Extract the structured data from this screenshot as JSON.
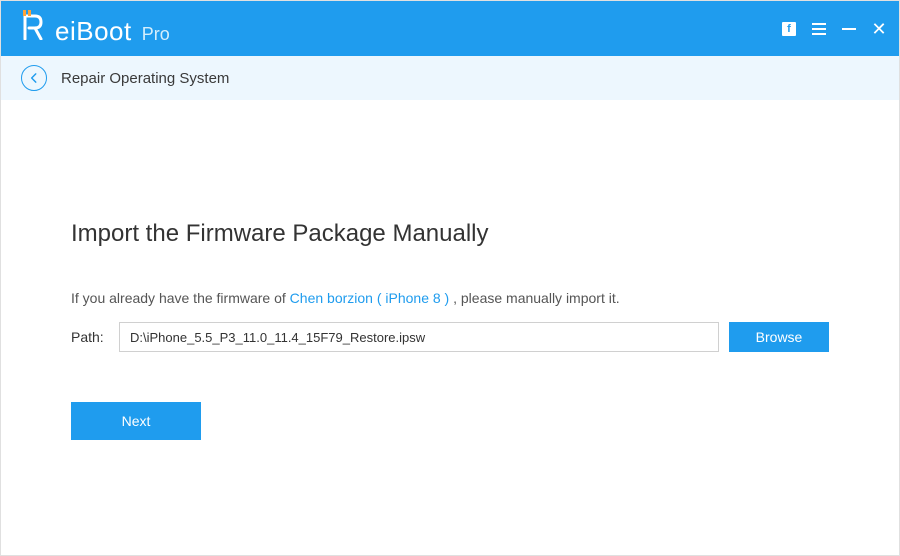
{
  "titlebar": {
    "brand_main": "eiBoot",
    "brand_suffix": "Pro"
  },
  "subheader": {
    "title": "Repair Operating System"
  },
  "main": {
    "heading": "Import the Firmware Package Manually",
    "instruction_before": "If you already have the firmware of ",
    "instruction_link": "Chen borzion ( iPhone 8 )",
    "instruction_after": " , please manually import it.",
    "path_label": "Path:",
    "path_value": "D:\\iPhone_5.5_P3_11.0_11.4_15F79_Restore.ipsw",
    "browse_label": "Browse",
    "next_label": "Next"
  }
}
